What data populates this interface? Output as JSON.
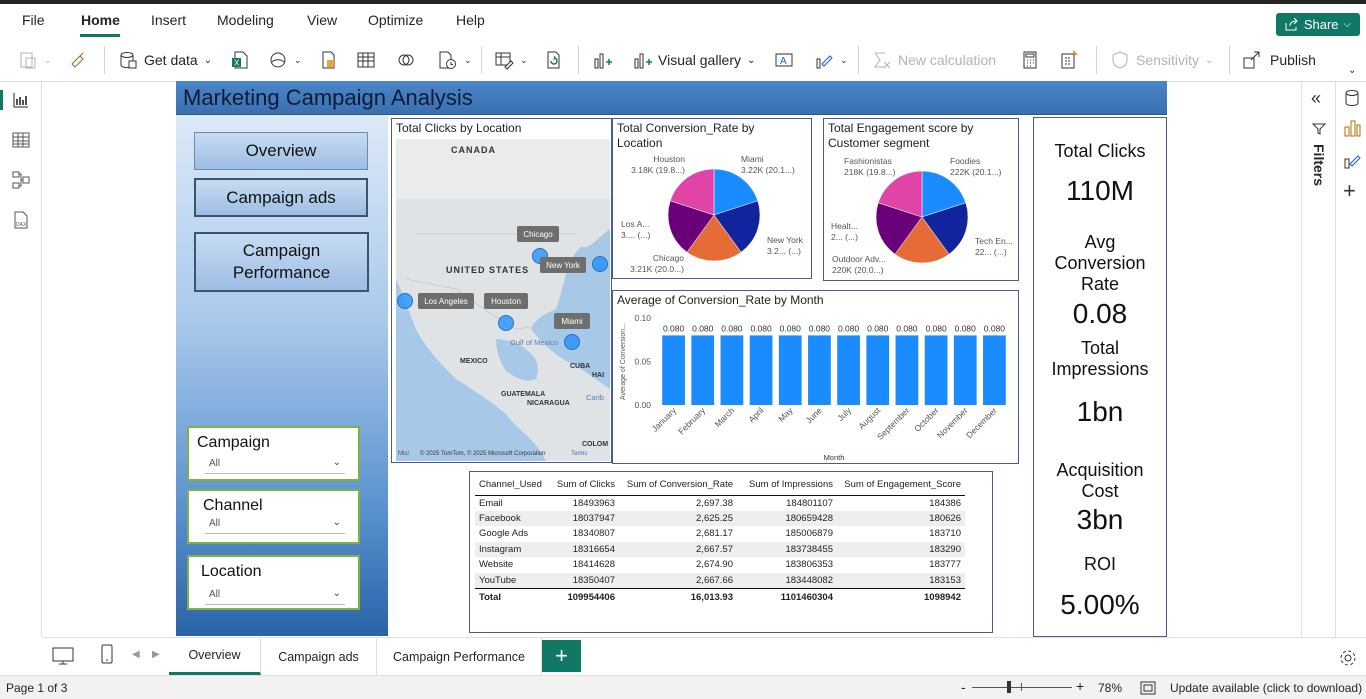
{
  "menubar": {
    "items": [
      "File",
      "Home",
      "Insert",
      "Modeling",
      "View",
      "Optimize",
      "Help"
    ],
    "share_label": "Share"
  },
  "ribbon": {
    "get_data": "Get data",
    "visual_gallery": "Visual gallery",
    "new_calculation": "New calculation",
    "sensitivity": "Sensitivity",
    "publish": "Publish"
  },
  "report": {
    "title": "Marketing Campaign Analysis",
    "nav_buttons": [
      "Overview",
      "Campaign ads",
      "Campaign Performance"
    ],
    "slicers": [
      {
        "title": "Campaign",
        "value": "All"
      },
      {
        "title": "Channel",
        "value": "All"
      },
      {
        "title": "Location",
        "value": "All"
      }
    ]
  },
  "map": {
    "title": "Total Clicks by Location",
    "labels": {
      "canada": "CANADA",
      "united_states": "UNITED STATES",
      "mexico": "MEXICO",
      "gulf": "Gulf of Mexico",
      "cuba": "CUBA",
      "haiti": "HAI",
      "guatemala": "GUATEMALA",
      "nicaragua": "NICARAGUA",
      "carib": "Carib",
      "colombia": "COLOM"
    },
    "cities": [
      "Chicago",
      "New York",
      "Los Angeles",
      "Houston",
      "Miami"
    ],
    "attribution": "© 2025 TomTom, © 2025 Microsoft Corporation",
    "terms": "Terms",
    "logo": "Micr"
  },
  "pie_location": {
    "title": "Total Conversion_Rate by Location",
    "labels": [
      {
        "name": "Houston",
        "value": "3.18K (19.8...)"
      },
      {
        "name": "Miami",
        "value": "3.22K (20.1...)"
      },
      {
        "name": "New York",
        "value": "3.2... (...)"
      },
      {
        "name": "Chicago",
        "value": "3.21K (20.0...)"
      },
      {
        "name": "Los A...",
        "value": "3.... (...)"
      }
    ]
  },
  "pie_segment": {
    "title": "Total Engagement score by Customer segment",
    "labels": [
      {
        "name": "Fashionistas",
        "value": "218K (19.8...)"
      },
      {
        "name": "Foodies",
        "value": "222K (20.1...)"
      },
      {
        "name": "Tech En...",
        "value": "22... (...)"
      },
      {
        "name": "Outdoor Adv...",
        "value": "220K (20.0...)"
      },
      {
        "name": "Healt...",
        "value": "2... (...)"
      }
    ]
  },
  "colors": {
    "slice1": "#1a8cff",
    "slice2": "#12239e",
    "slice3": "#e66c37",
    "slice4": "#6b007b",
    "slice5": "#e044a7",
    "accent": "#117865"
  },
  "chart_data": {
    "type": "bar",
    "title": "Average of Conversion_Rate by Month",
    "xlabel": "Month",
    "ylabel": "Average of Conversion...",
    "categories": [
      "January",
      "February",
      "March",
      "April",
      "May",
      "June",
      "July",
      "August",
      "September",
      "October",
      "November",
      "December"
    ],
    "values": [
      0.08,
      0.08,
      0.08,
      0.08,
      0.08,
      0.08,
      0.08,
      0.08,
      0.08,
      0.08,
      0.08,
      0.08
    ],
    "data_labels": [
      "0.080",
      "0.080",
      "0.080",
      "0.080",
      "0.080",
      "0.080",
      "0.080",
      "0.080",
      "0.080",
      "0.080",
      "0.080",
      "0.080"
    ],
    "yticks": [
      "0.10",
      "0.05",
      "0.00"
    ],
    "ylim": [
      0,
      0.1
    ]
  },
  "table": {
    "headers": [
      "Channel_Used",
      "Sum of Clicks",
      "Sum of Conversion_Rate",
      "Sum of Impressions",
      "Sum of Engagement_Score"
    ],
    "rows": [
      [
        "Email",
        "18493963",
        "2,697.38",
        "184801107",
        "184386"
      ],
      [
        "Facebook",
        "18037947",
        "2,625.25",
        "180659428",
        "180626"
      ],
      [
        "Google Ads",
        "18340807",
        "2,681.17",
        "185006879",
        "183710"
      ],
      [
        "Instagram",
        "18316654",
        "2,667.57",
        "183738455",
        "183290"
      ],
      [
        "Website",
        "18414628",
        "2,674.90",
        "183806353",
        "183777"
      ],
      [
        "YouTube",
        "18350407",
        "2,667.66",
        "183448082",
        "183153"
      ]
    ],
    "total": [
      "Total",
      "109954406",
      "16,013.93",
      "1101460304",
      "1098942"
    ]
  },
  "kpis": [
    {
      "label": "Total Clicks",
      "value": "110M"
    },
    {
      "label": "Avg Conversion Rate",
      "value": "0.08"
    },
    {
      "label": "Total Impressions",
      "value": "1bn"
    },
    {
      "label": "Acquisition Cost",
      "value": "3bn"
    },
    {
      "label": "ROI",
      "value": "5.00%"
    }
  ],
  "filters_label": "Filters",
  "tabs": [
    "Overview",
    "Campaign ads",
    "Campaign Performance"
  ],
  "status": {
    "page": "Page 1 of 3",
    "zoom": "78%",
    "update": "Update available (click to download)"
  }
}
